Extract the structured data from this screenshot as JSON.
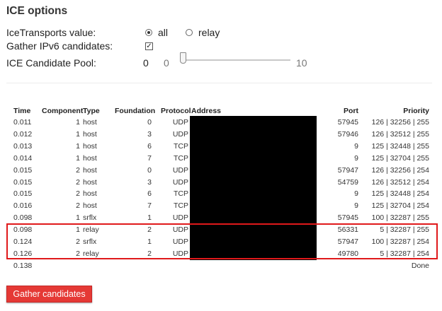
{
  "section_title": "ICE options",
  "options": {
    "ice_transports_label": "IceTransports value:",
    "radio_all": "all",
    "radio_relay": "relay",
    "gather_ipv6_label": "Gather IPv6 candidates:",
    "gather_ipv6_checked": true,
    "pool_label": "ICE Candidate Pool:",
    "pool_value": "0",
    "slider_min": "0",
    "slider_max": "10",
    "slider_level": 0
  },
  "table": {
    "headers": {
      "time": "Time",
      "component": "Component",
      "type": "Type",
      "foundation": "Foundation",
      "protocol": "Protocol",
      "address": "Address",
      "port": "Port",
      "priority": "Priority"
    },
    "rows": [
      {
        "time": "0.011",
        "component": "1",
        "type": "host",
        "foundation": "0",
        "protocol": "UDP",
        "port": "57945",
        "priority": "126 | 32256 | 255"
      },
      {
        "time": "0.012",
        "component": "1",
        "type": "host",
        "foundation": "3",
        "protocol": "UDP",
        "port": "57946",
        "priority": "126 | 32512 | 255"
      },
      {
        "time": "0.013",
        "component": "1",
        "type": "host",
        "foundation": "6",
        "protocol": "TCP",
        "port": "9",
        "priority": "125 | 32448 | 255"
      },
      {
        "time": "0.014",
        "component": "1",
        "type": "host",
        "foundation": "7",
        "protocol": "TCP",
        "port": "9",
        "priority": "125 | 32704 | 255"
      },
      {
        "time": "0.015",
        "component": "2",
        "type": "host",
        "foundation": "0",
        "protocol": "UDP",
        "port": "57947",
        "priority": "126 | 32256 | 254"
      },
      {
        "time": "0.015",
        "component": "2",
        "type": "host",
        "foundation": "3",
        "protocol": "UDP",
        "port": "54759",
        "priority": "126 | 32512 | 254"
      },
      {
        "time": "0.015",
        "component": "2",
        "type": "host",
        "foundation": "6",
        "protocol": "TCP",
        "port": "9",
        "priority": "125 | 32448 | 254"
      },
      {
        "time": "0.016",
        "component": "2",
        "type": "host",
        "foundation": "7",
        "protocol": "TCP",
        "port": "9",
        "priority": "125 | 32704 | 254"
      },
      {
        "time": "0.098",
        "component": "1",
        "type": "srflx",
        "foundation": "1",
        "protocol": "UDP",
        "port": "57945",
        "priority": "100 | 32287 | 255"
      },
      {
        "time": "0.098",
        "component": "1",
        "type": "relay",
        "foundation": "2",
        "protocol": "UDP",
        "port": "56331",
        "priority": "5 | 32287 | 255"
      },
      {
        "time": "0.124",
        "component": "2",
        "type": "srflx",
        "foundation": "1",
        "protocol": "UDP",
        "port": "57947",
        "priority": "100 | 32287 | 254"
      },
      {
        "time": "0.126",
        "component": "2",
        "type": "relay",
        "foundation": "2",
        "protocol": "UDP",
        "port": "49780",
        "priority": "5 | 32287 | 254"
      }
    ],
    "final_time": "0.138",
    "done_label": "Done"
  },
  "gather_button_label": "Gather candidates",
  "colors": {
    "button_bg": "#e53935",
    "highlight": "#e0191b",
    "redaction": "#000000"
  }
}
